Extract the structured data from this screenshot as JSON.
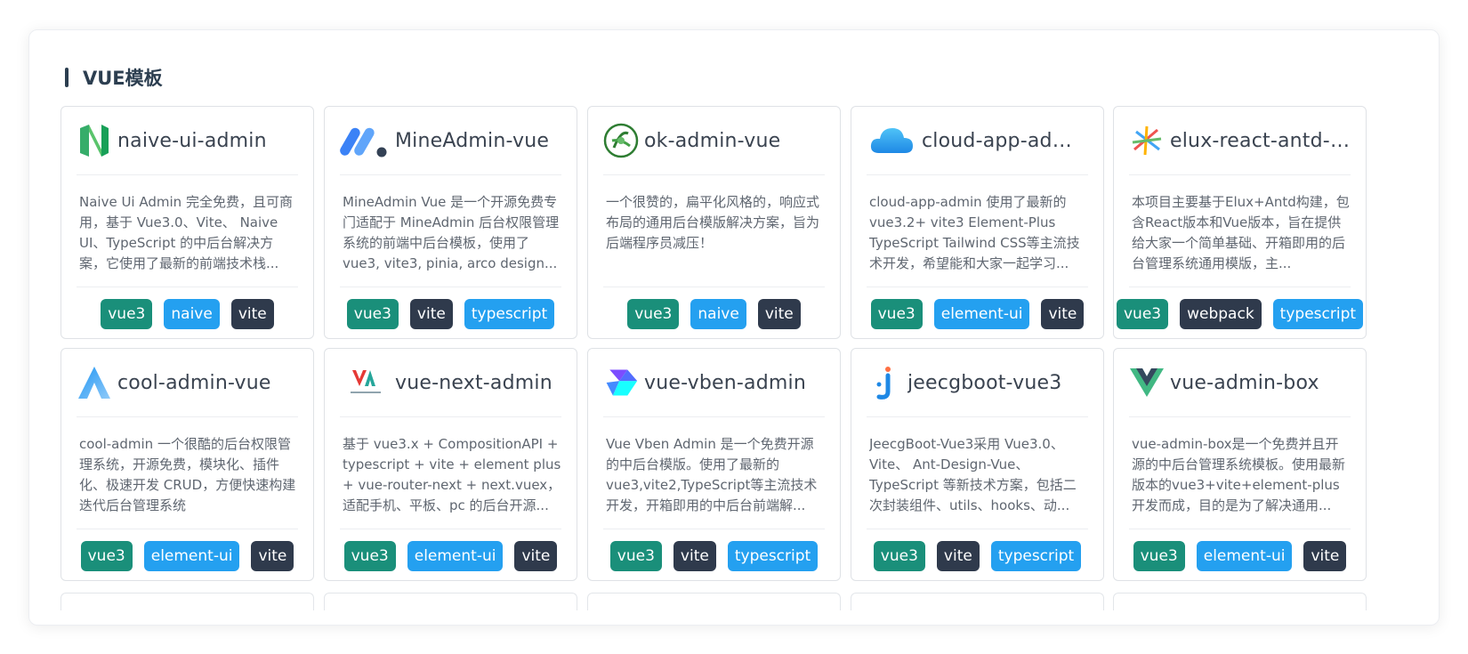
{
  "section": {
    "title": "VUE模板"
  },
  "colors": {
    "vue3": "#1a8f7a",
    "dark": "#2f3a4c",
    "blue": "#24a0f0",
    "title": "#2c3e50"
  },
  "cards": [
    {
      "name": "naive-ui-admin",
      "icon": "naive-ui-logo-icon",
      "desc": "Naive Ui Admin 完全免费，且可商用，基于 Vue3.0、Vite、 Naive UI、TypeScript 的中后台解决方案，它使用了最新的前端技术栈...",
      "tags": [
        "vue3",
        "naive",
        "vite"
      ]
    },
    {
      "name": "MineAdmin-vue",
      "icon": "mineadmin-logo-icon",
      "desc": "MineAdmin Vue 是一个开源免费专门适配于 MineAdmin 后台权限管理系统的前端中后台模板，使用了 vue3, vite3, pinia, arco design...",
      "tags": [
        "vue3",
        "vite",
        "typescript"
      ]
    },
    {
      "name": "ok-admin-vue",
      "icon": "ok-admin-logo-icon",
      "desc": "一个很赞的，扁平化风格的，响应式布局的通用后台模版解决方案，旨为后端程序员减压！",
      "tags": [
        "vue3",
        "naive",
        "vite"
      ]
    },
    {
      "name": "cloud-app-admin",
      "icon": "cloud-logo-icon",
      "desc": "cloud-app-admin 使用了最新的vue3.2+ vite3 Element-Plus TypeScript Tailwind CSS等主流技术开发，希望能和大家一起学习...",
      "tags": [
        "vue3",
        "element-ui",
        "vite"
      ]
    },
    {
      "name": "elux-react-antd-admin",
      "icon": "elux-logo-icon",
      "desc": "本项目主要基于Elux+Antd构建，包含React版本和Vue版本，旨在提供给大家一个简单基础、开箱即用的后台管理系统通用模版，主...",
      "tags": [
        "vue3",
        "webpack",
        "typescript"
      ]
    },
    {
      "name": "cool-admin-vue",
      "icon": "cool-admin-logo-icon",
      "desc": "cool-admin 一个很酷的后台权限管理系统，开源免费，模块化、插件化、极速开发 CRUD，方便快速构建迭代后台管理系统",
      "tags": [
        "vue3",
        "element-ui",
        "vite"
      ]
    },
    {
      "name": "vue-next-admin",
      "icon": "vue-next-admin-logo-icon",
      "desc": "基于 vue3.x + CompositionAPI + typescript + vite + element plus + vue-router-next + next.vuex，适配手机、平板、pc 的后台开源...",
      "tags": [
        "vue3",
        "element-ui",
        "vite"
      ]
    },
    {
      "name": "vue-vben-admin",
      "icon": "vben-logo-icon",
      "desc": "Vue Vben Admin 是一个免费开源的中后台模版。使用了最新的vue3,vite2,TypeScript等主流技术开发，开箱即用的中后台前端解...",
      "tags": [
        "vue3",
        "vite",
        "typescript"
      ]
    },
    {
      "name": "jeecgboot-vue3",
      "icon": "jeecg-logo-icon",
      "desc": "JeecgBoot-Vue3采用 Vue3.0、Vite、 Ant-Design-Vue、TypeScript 等新技术方案，包括二次封装组件、utils、hooks、动...",
      "tags": [
        "vue3",
        "vite",
        "typescript"
      ]
    },
    {
      "name": "vue-admin-box",
      "icon": "vue-logo-icon",
      "desc": "vue-admin-box是一个免费并且开源的中后台管理系统模板。使用最新版本的vue3+vite+element-plus开发而成，目的是为了解决通用...",
      "tags": [
        "vue3",
        "element-ui",
        "vite"
      ]
    }
  ]
}
